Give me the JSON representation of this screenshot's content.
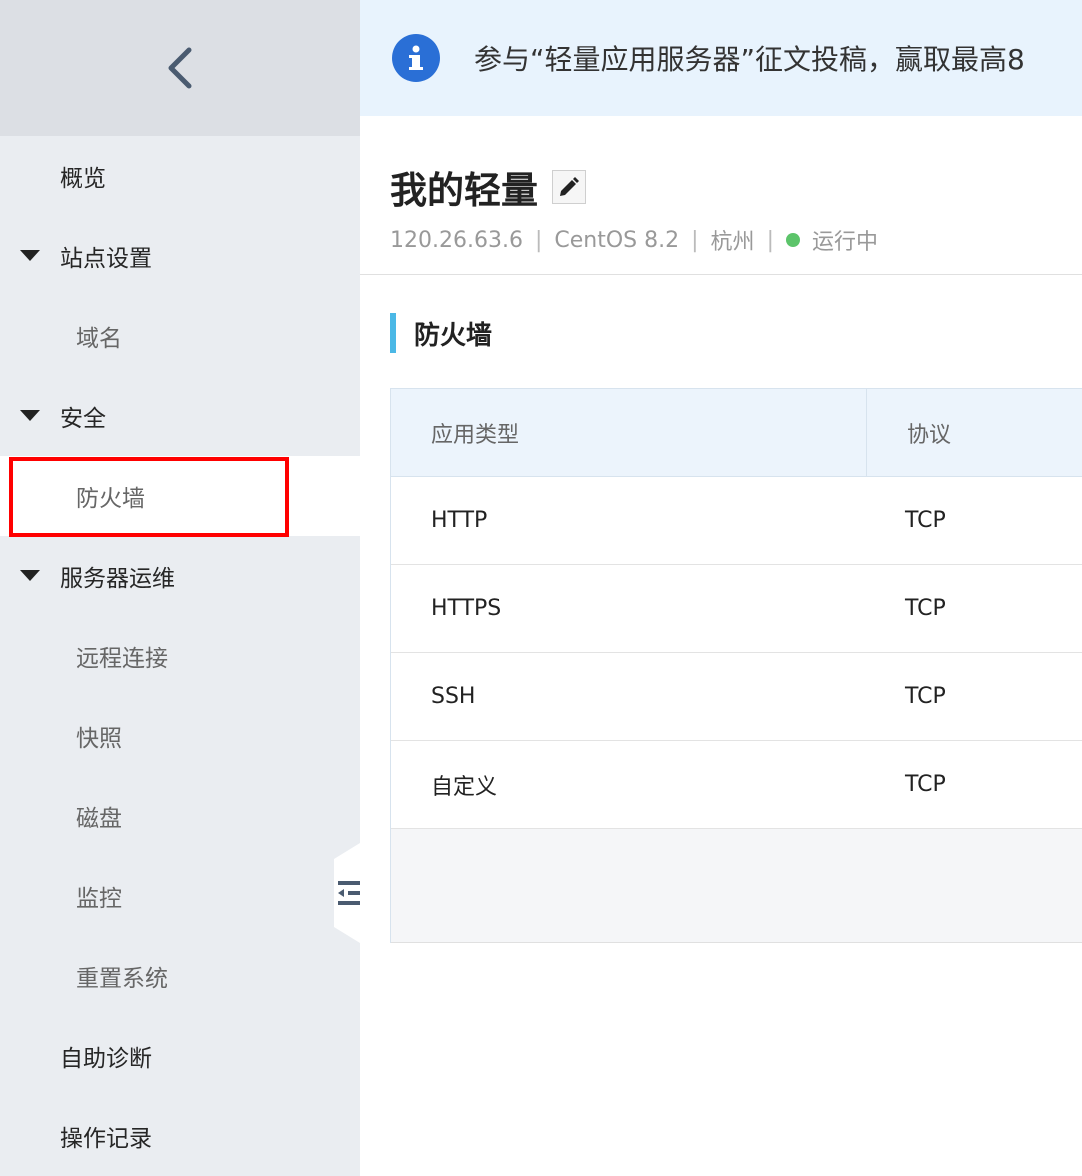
{
  "sidebar": {
    "back_icon": "chevron-left-icon",
    "items": [
      {
        "label": "概览"
      },
      {
        "label": "站点设置"
      },
      {
        "label": "域名"
      },
      {
        "label": "安全"
      },
      {
        "label": "防火墙"
      },
      {
        "label": "服务器运维"
      },
      {
        "label": "远程连接"
      },
      {
        "label": "快照"
      },
      {
        "label": "磁盘"
      },
      {
        "label": "监控"
      },
      {
        "label": "重置系统"
      },
      {
        "label": "自助诊断"
      },
      {
        "label": "操作记录"
      }
    ]
  },
  "notice": {
    "icon": "info-icon",
    "text": "参与“轻量应用服务器”征文投稿，赢取最高8"
  },
  "instance": {
    "title": "我的轻量",
    "ip": "120.26.63.6",
    "os": "CentOS  8.2",
    "region": "杭州",
    "status": "运行中",
    "separator": "|"
  },
  "section": {
    "title": "防火墙"
  },
  "table": {
    "headers": [
      "应用类型",
      "协议"
    ],
    "rows": [
      [
        "HTTP",
        "TCP"
      ],
      [
        "HTTPS",
        "TCP"
      ],
      [
        "SSH",
        "TCP"
      ],
      [
        "自定义",
        "TCP"
      ]
    ]
  },
  "colors": {
    "sidebar_bg": "#eaedf1",
    "notice_bg": "#e8f3fd",
    "accent": "#4bb8e6",
    "info_icon": "#2a6fd6",
    "status_running": "#5cc46a",
    "highlight": "#ff0000"
  }
}
